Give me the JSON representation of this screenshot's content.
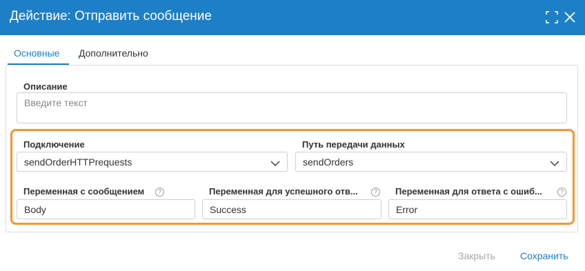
{
  "dialog": {
    "title": "Действие: Отправить сообщение"
  },
  "tabs": [
    {
      "label": "Основные",
      "active": true
    },
    {
      "label": "Дополнительно",
      "active": false
    }
  ],
  "form": {
    "description": {
      "label": "Описание",
      "placeholder": "Введите текст",
      "value": ""
    },
    "connection": {
      "label": "Подключение",
      "value": "sendOrderHTTPrequests"
    },
    "data_path": {
      "label": "Путь передачи данных",
      "value": "sendOrders"
    },
    "message_var": {
      "label": "Переменная с сообщением",
      "value": "Body"
    },
    "success_var": {
      "label": "Переменная для успешного отв...",
      "value": "Success"
    },
    "error_var": {
      "label": "Переменная для ответа с ошиб...",
      "value": "Error"
    },
    "help_glyph": "?"
  },
  "footer": {
    "close_label": "Закрыть",
    "save_label": "Сохранить"
  },
  "colors": {
    "accent": "#1d7fc6",
    "highlight": "#f0982c",
    "disabled_text": "#a8a8a8"
  },
  "icons": {
    "expand": "expand-icon",
    "close": "close-icon",
    "dropdown": "chevron-down-icon",
    "help": "help-icon"
  }
}
